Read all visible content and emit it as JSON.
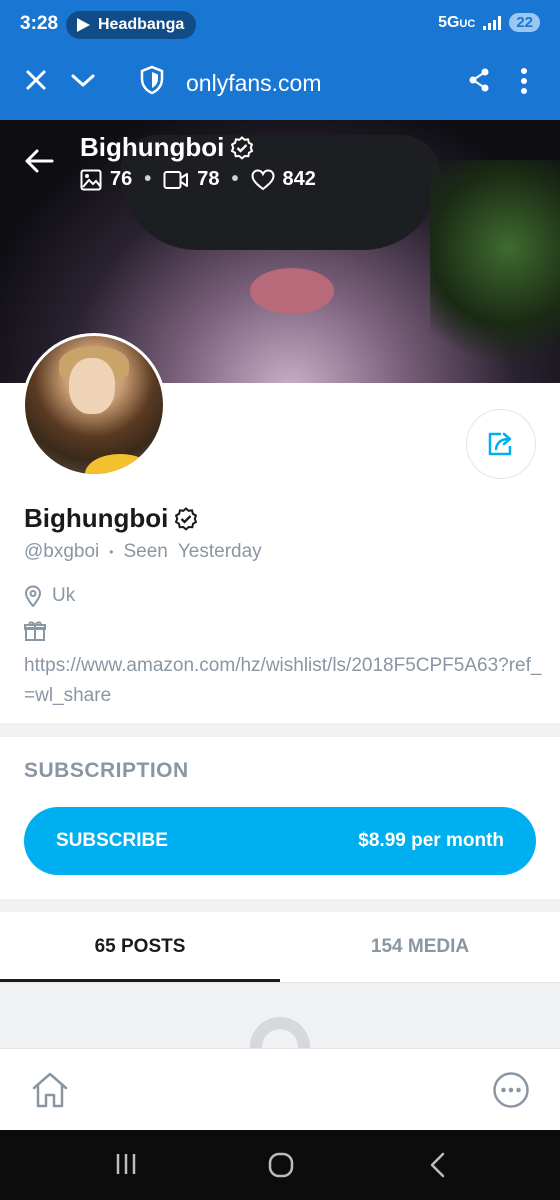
{
  "status_bar": {
    "time": "3:28",
    "notification_app": "Headbanga",
    "network": "5G",
    "network_sub": "UC",
    "battery": "22"
  },
  "browser": {
    "url": "onlyfans.com",
    "icons": [
      "close-icon",
      "chevron-down-icon",
      "shield-icon",
      "share-icon",
      "more-vertical-icon"
    ]
  },
  "cover": {
    "name": "Bighungboi",
    "photos_count": "76",
    "videos_count": "78",
    "likes_count": "842"
  },
  "profile": {
    "name": "Bighungboi",
    "handle": "@bxgboi",
    "separator": "•",
    "seen_label": "Seen",
    "seen_value": "Yesterday",
    "location": "Uk",
    "wishlist_url": "https://www.amazon.com/hz/wishlist/ls/2018F5CPF5A63?ref_=wl_share"
  },
  "subscription": {
    "title": "SUBSCRIPTION",
    "button_label": "SUBSCRIBE",
    "price": "$8.99 per month"
  },
  "tabs": [
    {
      "label": "65 POSTS",
      "active": true
    },
    {
      "label": "154 MEDIA",
      "active": false
    }
  ],
  "colors": {
    "chrome_blue": "#1976d2",
    "accent": "#00aff0",
    "muted_text": "#8a96a3"
  }
}
